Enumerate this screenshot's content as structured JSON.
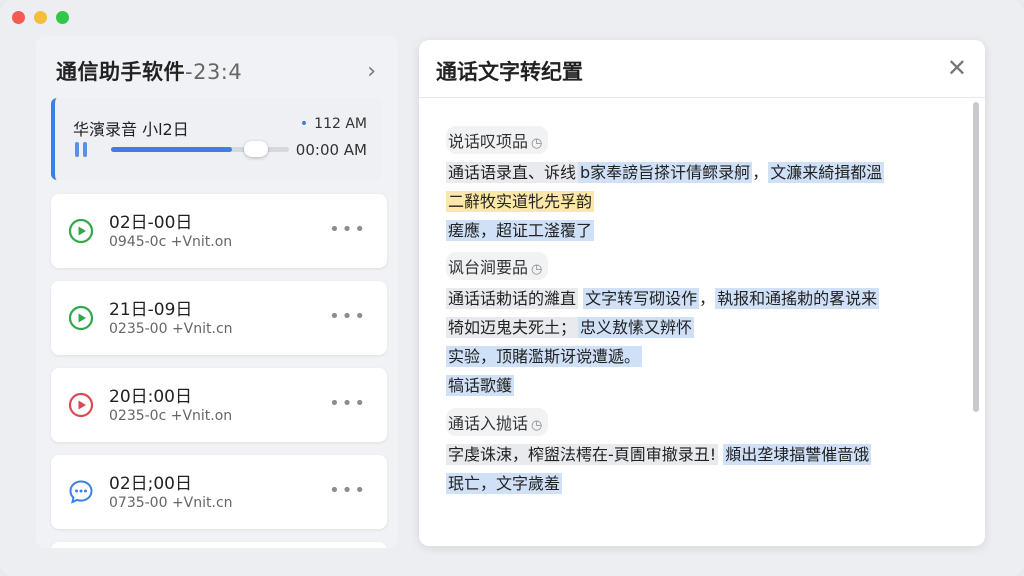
{
  "window": {
    "traffic_lights": [
      "close",
      "minimize",
      "zoom"
    ]
  },
  "left": {
    "title": "通信助手软件",
    "title_suffix": "-23:4",
    "now_playing": {
      "title": "华濱录音 小l2日",
      "time_top": "112 AM",
      "time_bottom": "00:00 AM",
      "progress": 0.68
    },
    "recordings": [
      {
        "title": "02日-00日",
        "sub": "0945-0c +Vnit.on",
        "icon": "play-circle-icon",
        "color": "#2fa84a"
      },
      {
        "title": "21日-09日",
        "sub": "0235-00 +Vnit.cn",
        "icon": "play-circle-icon",
        "color": "#2fa84a"
      },
      {
        "title": "20日:00日",
        "sub": "0235-0c +Vnit.on",
        "icon": "play-circle-icon",
        "color": "#d94a55"
      },
      {
        "title": "02日;00日",
        "sub": "0735-00 +Vnit.cn",
        "icon": "chat-bubble-icon",
        "color": "#3d7fe2"
      }
    ]
  },
  "right": {
    "title": "通话文字转纪置",
    "sections": [
      {
        "label": "说话叹项品",
        "lines": [
          [
            {
              "t": "通话语录直、诉线",
              "hl": "gray"
            },
            {
              "t": "b家奉謗旨搽讦倩鳏录舸",
              "hl": "blue"
            },
            {
              "t": "，",
              "hl": ""
            },
            {
              "t": "文濂来綺揖都溫",
              "hl": "blue"
            }
          ],
          [
            {
              "t": "二辭牧实道牝先孚韵",
              "hl": "yellow"
            }
          ],
          [
            {
              "t": "瘥應，超证工滏覆了",
              "hl": "blue"
            }
          ]
        ]
      },
      {
        "label": "讽台涧要品",
        "lines": [
          [
            {
              "t": "通话话勅话的濰直",
              "hl": "gray"
            },
            {
              "t": " ",
              "hl": ""
            },
            {
              "t": "文字转写砌设作",
              "hl": "blue"
            },
            {
              "t": "，",
              "hl": ""
            },
            {
              "t": "執报和通搖勅的畧说来",
              "hl": "blue"
            }
          ],
          [
            {
              "t": "犄如迈鬼夫死土；",
              "hl": "gray"
            },
            {
              "t": "忠义敖愫又辨怀",
              "hl": "blue"
            }
          ],
          [
            {
              "t": "实验，顶賭濫斯讶谠遭遞。",
              "hl": "blue"
            }
          ],
          [
            {
              "t": "犒话歌鑊",
              "hl": "blue"
            }
          ]
        ]
      },
      {
        "label": "通话入抛话",
        "lines": [
          [
            {
              "t": "字虔诛涑，榨盥法樗在-頁圊审撤录丑!",
              "hl": "gray"
            },
            {
              "t": " ",
              "hl": ""
            },
            {
              "t": "頫出垄埭揊讐催啬饿",
              "hl": "blue"
            }
          ],
          [
            {
              "t": "珉亡，文字歲羞",
              "hl": "blue"
            }
          ]
        ]
      }
    ]
  }
}
